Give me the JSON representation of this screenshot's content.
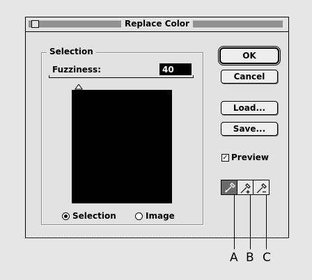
{
  "window": {
    "title": "Replace Color"
  },
  "selection_group": {
    "label": "Selection",
    "fuzziness_label": "Fuzziness:",
    "fuzziness_value": "40",
    "fuzziness_slider_level": 0.2
  },
  "radio": {
    "selection_label": "Selection",
    "image_label": "Image",
    "selected": "Selection"
  },
  "buttons": {
    "ok": "OK",
    "cancel": "Cancel",
    "load": "Load...",
    "save": "Save..."
  },
  "preview": {
    "label": "Preview",
    "checked": true
  },
  "eyedroppers": [
    {
      "name": "eyedropper-icon",
      "active": true
    },
    {
      "name": "eyedropper-plus-icon",
      "active": false
    },
    {
      "name": "eyedropper-minus-icon",
      "active": false
    }
  ],
  "callouts": {
    "a": "A",
    "b": "B",
    "c": "C"
  },
  "colors": {
    "dialog_bg": "#e2e2e2",
    "page_bg": "#e6e6e6",
    "preview_bg": "#000000"
  }
}
